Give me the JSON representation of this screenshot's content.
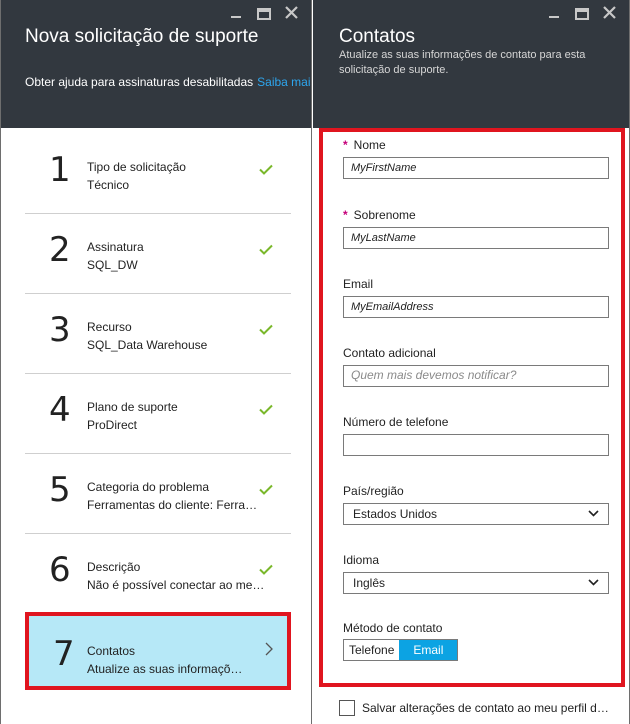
{
  "left_blade": {
    "title": "Nova solicitação de suporte",
    "help_text": "Obter ajuda para assinaturas desabilitadas",
    "help_link": "Saiba mais",
    "steps": [
      {
        "number": "1",
        "title": "Tipo de solicitação",
        "value": "Técnico",
        "status": "complete"
      },
      {
        "number": "2",
        "title": "Assinatura",
        "value": "SQL_DW",
        "status": "complete"
      },
      {
        "number": "3",
        "title": "Recurso",
        "value": "SQL_Data Warehouse",
        "status": "complete"
      },
      {
        "number": "4",
        "title": "Plano de suporte",
        "value": "ProDirect",
        "status": "complete"
      },
      {
        "number": "5",
        "title": "Categoria do problema",
        "value": "Ferramentas do cliente: Ferrame...",
        "status": "complete"
      },
      {
        "number": "6",
        "title": "Descrição",
        "value": "Não é possível conectar ao meu...",
        "status": "complete"
      },
      {
        "number": "7",
        "title": "Contatos",
        "value": "Atualize as suas informações...",
        "status": "active"
      }
    ]
  },
  "right_blade": {
    "title": "Contatos",
    "subtitle": "Atualize as suas informações de contato para esta solicitação de suporte.",
    "fields": {
      "first_name": {
        "label": "Nome",
        "value": "MyFirstName",
        "required": true
      },
      "last_name": {
        "label": "Sobrenome",
        "value": "MyLastName",
        "required": true
      },
      "email": {
        "label": "Email",
        "value": "MyEmailAddress"
      },
      "additional_contact": {
        "label": "Contato adicional",
        "placeholder": "Quem mais devemos notificar?",
        "value": ""
      },
      "phone": {
        "label": "Número de telefone",
        "value": ""
      },
      "country": {
        "label": "País/região",
        "selected": "Estados Unidos"
      },
      "language": {
        "label": "Idioma",
        "selected": "Inglês"
      },
      "contact_method": {
        "label": "Método de contato",
        "options": [
          "Telefone",
          "Email"
        ],
        "selected": "Email"
      }
    },
    "required_marker": "*",
    "save_label": "Salvar alterações de contato ao meu perfil de..."
  },
  "colors": {
    "header_bg": "#32383f",
    "link": "#2ea6ee",
    "check": "#7ab82b",
    "highlight_border": "#e0151f",
    "active_step_bg": "#b6e8f7",
    "toggle_selected": "#0ca3e3",
    "required": "#c5007a"
  },
  "icons": {
    "minimize": "minimize-icon",
    "maximize": "maximize-icon",
    "close": "close-icon",
    "external_link": "external-link-icon",
    "check": "check-icon",
    "chevron_right": "chevron-right-icon",
    "chevron_down": "chevron-down-icon"
  }
}
